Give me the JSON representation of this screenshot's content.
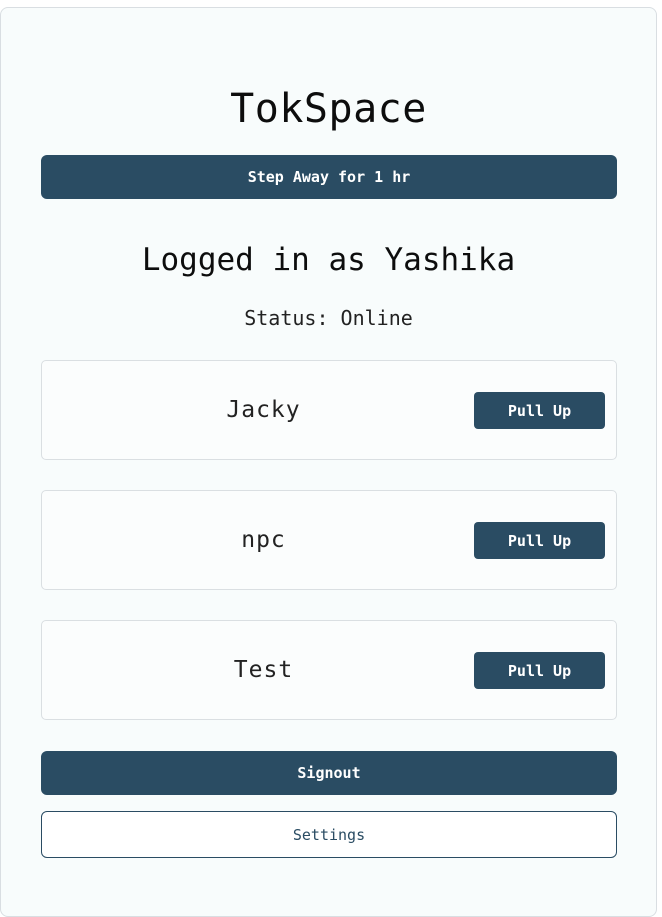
{
  "app": {
    "title": "TokSpace"
  },
  "actions": {
    "step_away_label": "Step Away for 1 hr",
    "signout_label": "Signout",
    "settings_label": "Settings"
  },
  "session": {
    "logged_in_text": "Logged in as Yashika",
    "status_text": "Status: Online"
  },
  "users": [
    {
      "name": "Jacky",
      "action_label": "Pull Up"
    },
    {
      "name": "npc",
      "action_label": "Pull Up"
    },
    {
      "name": "Test",
      "action_label": "Pull Up"
    }
  ],
  "colors": {
    "primary": "#2a4c63",
    "card_background": "#f8fcfc",
    "border": "#d9dee2"
  }
}
